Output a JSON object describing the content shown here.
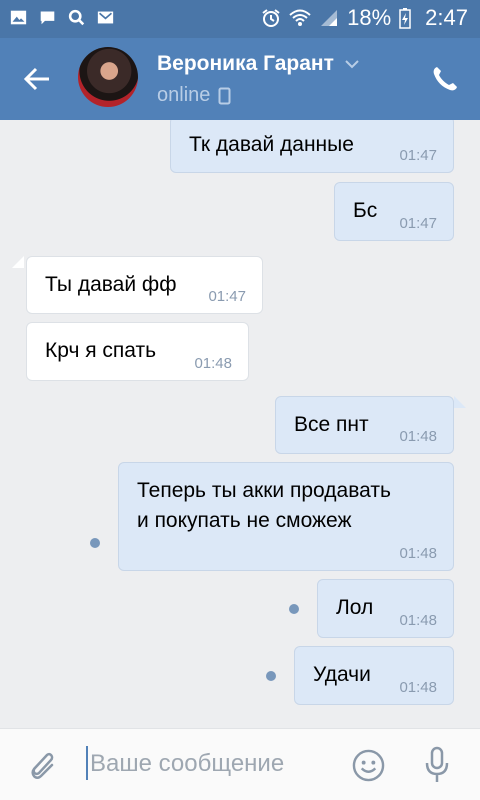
{
  "status_bar": {
    "battery": "18%",
    "time": "2:47"
  },
  "header": {
    "name": "Вероника Гарант",
    "status": "online"
  },
  "messages": [
    {
      "dir": "out",
      "text": "Тк давай данные",
      "time": "01:47"
    },
    {
      "dir": "out",
      "text": "Бс",
      "time": "01:47"
    },
    {
      "dir": "in",
      "text": "Ты давай фф",
      "time": "01:47"
    },
    {
      "dir": "in",
      "text": "Крч я спать",
      "time": "01:48"
    },
    {
      "dir": "out",
      "text": "Все пнт",
      "time": "01:48"
    },
    {
      "dir": "out",
      "text": "Теперь ты акки продавать\nи покупать не сможеж",
      "time": "01:48",
      "unread": true
    },
    {
      "dir": "out",
      "text": "Лол",
      "time": "01:48",
      "unread": true
    },
    {
      "dir": "out",
      "text": "Удачи",
      "time": "01:48",
      "unread": true
    }
  ],
  "composer": {
    "placeholder": "Ваше сообщение"
  },
  "colors": {
    "header": "#5181b8",
    "statusbar": "#4a76a8",
    "outgoing": "#dce8f7",
    "incoming": "#ffffff",
    "unread_dot": "#7897bb"
  },
  "icons": [
    "image-icon",
    "chat-icon",
    "search-icon",
    "mail-icon",
    "alarm-icon",
    "wifi-icon",
    "signal-icon",
    "battery-icon",
    "back-arrow-icon",
    "chevron-down-icon",
    "phone-icon",
    "call-icon",
    "attach-icon",
    "emoji-icon",
    "mic-icon"
  ]
}
